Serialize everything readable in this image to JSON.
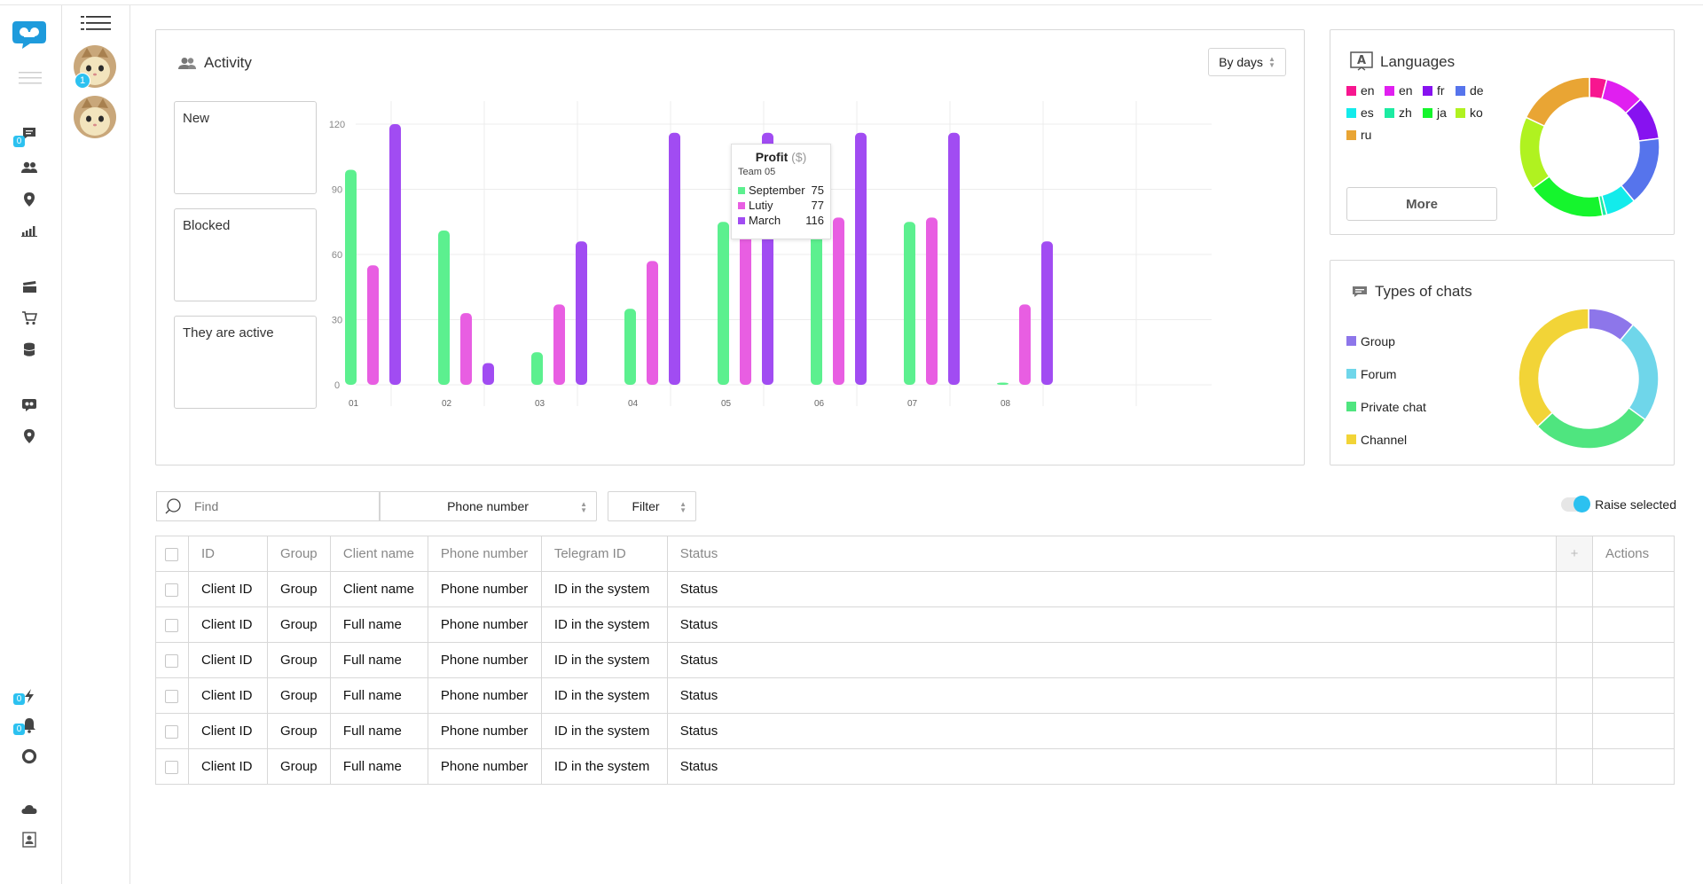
{
  "sidebar": {
    "badges": {
      "chats": "0",
      "lightning": "0",
      "bell": "0"
    }
  },
  "avatars": {
    "badge": "1"
  },
  "activity": {
    "title": "Activity",
    "period_label": "By days",
    "stats": [
      {
        "label": "New"
      },
      {
        "label": "Blocked"
      },
      {
        "label": "They are active"
      }
    ],
    "tooltip": {
      "title": "Profit",
      "unit": "($)",
      "subtitle": "Team 05",
      "rows": [
        {
          "name": "September",
          "value": "75"
        },
        {
          "name": "Lutiy",
          "value": "77"
        },
        {
          "name": "March",
          "value": "116"
        }
      ]
    }
  },
  "chart_data": [
    {
      "type": "bar",
      "title": "",
      "categories": [
        "01",
        "02",
        "03",
        "04",
        "05",
        "06",
        "07",
        "08"
      ],
      "series": [
        {
          "name": "September",
          "color": "#5cf08f",
          "values": [
            99,
            71,
            15,
            35,
            75,
            75,
            75,
            1
          ]
        },
        {
          "name": "Lutiy",
          "color": "#e85ee2",
          "values": [
            55,
            33,
            37,
            57,
            77,
            77,
            77,
            37
          ]
        },
        {
          "name": "March",
          "color": "#a14cf2",
          "values": [
            120,
            10,
            66,
            116,
            116,
            116,
            116,
            66
          ]
        }
      ],
      "y_ticks": [
        "0",
        "30",
        "60",
        "90",
        "120"
      ],
      "ylim": [
        0,
        120
      ],
      "grid": true,
      "active_category": "05"
    },
    {
      "type": "pie",
      "title": "Languages",
      "labels": [
        "en",
        "en",
        "fr",
        "de",
        "es",
        "zh",
        "ja",
        "ko",
        "ru"
      ],
      "colors": [
        "#f7168f",
        "#e01ff0",
        "#8712f0",
        "#5674ec",
        "#13ebeb",
        "#1ceba2",
        "#15f52d",
        "#b0f220",
        "#e9a534"
      ],
      "values": [
        4,
        9,
        10,
        16,
        7,
        1,
        18,
        17,
        18
      ]
    },
    {
      "type": "pie",
      "title": "Types of chats",
      "labels": [
        "Group",
        "Forum",
        "Private chat",
        "Channel"
      ],
      "colors": [
        "#8d76ea",
        "#6fd6ea",
        "#4fe57f",
        "#f2d437"
      ],
      "values": [
        11,
        24,
        28,
        37
      ]
    }
  ],
  "languages": {
    "title": "Languages",
    "more_label": "More"
  },
  "chat_types": {
    "title": "Types of chats"
  },
  "toolbar": {
    "find_placeholder": "Find",
    "phone_select": "Phone number",
    "filter_select": "Filter",
    "raise_selected": "Raise selected"
  },
  "table": {
    "headers": {
      "id": "ID",
      "group": "Group",
      "client_name": "Client name",
      "phone": "Phone number",
      "telegram": "Telegram ID",
      "status": "Status",
      "plus": "+",
      "actions": "Actions"
    },
    "rows": [
      {
        "id": "Client ID",
        "group": "Group",
        "name": "Client name",
        "phone": "Phone number",
        "telegram": "ID in the system",
        "status": "Status"
      },
      {
        "id": "Client ID",
        "group": "Group",
        "name": "Full name",
        "phone": "Phone number",
        "telegram": "ID in the system",
        "status": "Status"
      },
      {
        "id": "Client ID",
        "group": "Group",
        "name": "Full name",
        "phone": "Phone number",
        "telegram": "ID in the system",
        "status": "Status"
      },
      {
        "id": "Client ID",
        "group": "Group",
        "name": "Full name",
        "phone": "Phone number",
        "telegram": "ID in the system",
        "status": "Status"
      },
      {
        "id": "Client ID",
        "group": "Group",
        "name": "Full name",
        "phone": "Phone number",
        "telegram": "ID in the system",
        "status": "Status"
      },
      {
        "id": "Client ID",
        "group": "Group",
        "name": "Full name",
        "phone": "Phone number",
        "telegram": "ID in the system",
        "status": "Status"
      }
    ]
  }
}
